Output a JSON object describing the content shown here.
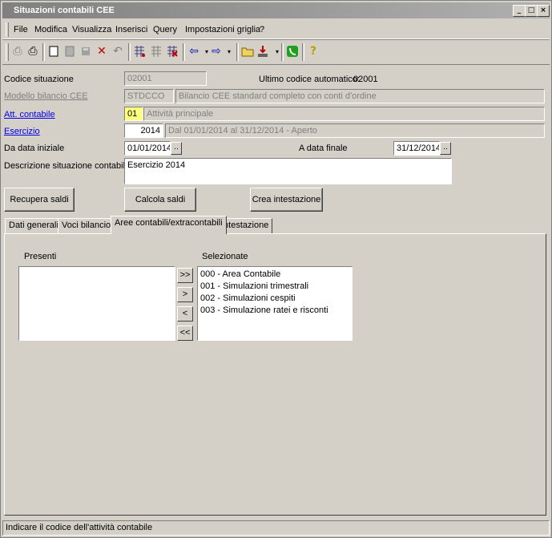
{
  "window": {
    "title": "Situazioni contabili CEE",
    "minimize": "_",
    "maximize": "□",
    "close": "×"
  },
  "menu": [
    "File",
    "Modifica",
    "Visualizza",
    "Inserisci",
    "Query",
    "Impostazioni griglia",
    "?"
  ],
  "toolbar_icons": [
    "print-preview-icon",
    "print-icon",
    "new-document-icon",
    "page-icon",
    "save-icon",
    "delete-icon",
    "undo-icon",
    "grid-filter-icon",
    "grid-icon",
    "grid-delete-icon",
    "arrow-left-icon",
    "arrow-right-icon",
    "open-folder-icon",
    "export-icon",
    "phone-icon",
    "help-icon"
  ],
  "form": {
    "codice_situazione_label": "Codice situazione",
    "codice_situazione_value": "02001",
    "ultimo_codice_label": "Ultimo codice automatico:",
    "ultimo_codice_value": "02001",
    "modello_label": "Modello bilancio CEE",
    "modello_code": "STDCCO",
    "modello_desc": "Bilancio CEE standard completo con conti d'ordine",
    "att_label": "Att. contabile",
    "att_code": "01",
    "att_desc": "Attività principale",
    "esercizio_label": "Esercizio",
    "esercizio_value": "2014",
    "esercizio_desc": "Dal 01/01/2014 al 31/12/2014 - Aperto",
    "da_data_label": "Da data iniziale",
    "da_data_value": "01/01/2014",
    "a_data_label": "A data finale",
    "a_data_value": "31/12/2014",
    "descrizione_label": "Descrizione situazione contabile",
    "descrizione_value": "Esercizio 2014",
    "dots": ".."
  },
  "buttons": {
    "recupera": "Recupera saldi",
    "calcola": "Calcola saldi",
    "crea": "Crea intestazione"
  },
  "tabs": [
    "Dati generali",
    "Voci bilancio",
    "Aree contabili/extracontabili",
    "Intestazione"
  ],
  "panel": {
    "presenti_label": "Presenti",
    "selezionate_label": "Selezionate",
    "move_buttons": [
      ">>",
      ">",
      "<",
      "<<"
    ],
    "selezionate_items": [
      "000 - Area Contabile",
      "001 - Simulazioni trimestrali",
      "002 - Simulazioni cespiti",
      "003 - Simulazione ratei e risconti"
    ]
  },
  "status": "Indicare il codice dell'attività contabile"
}
